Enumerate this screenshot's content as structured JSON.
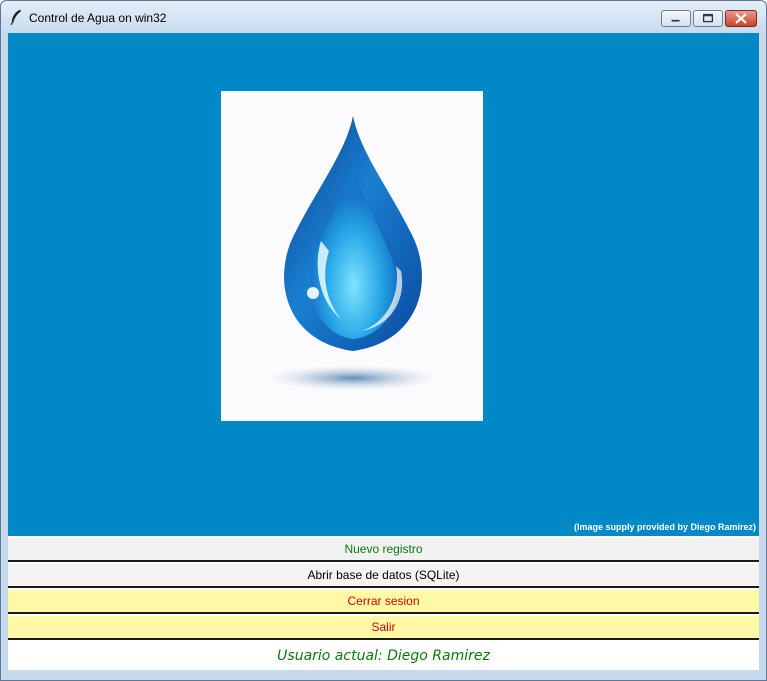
{
  "window": {
    "title": "Control de Agua on win32",
    "icon": "feather-icon",
    "controls": [
      "minimize-icon",
      "maximize-icon",
      "close-icon"
    ]
  },
  "canvas": {
    "background": "#0088c7",
    "image_icon": "water-drop-icon",
    "credit": "(Image supply provided by Diego Ramirez)"
  },
  "buttons": {
    "nuevo": "Nuevo registro",
    "abrir": "Abrir base de datos (SQLite)",
    "cerrar": "Cerrar sesion",
    "salir": "Salir"
  },
  "status": {
    "user_label": "Usuario actual: Diego Ramirez"
  },
  "colors": {
    "green_text": "#0a7a0a",
    "red_text": "#cc0000",
    "yellow_button": "#fff9a6"
  }
}
